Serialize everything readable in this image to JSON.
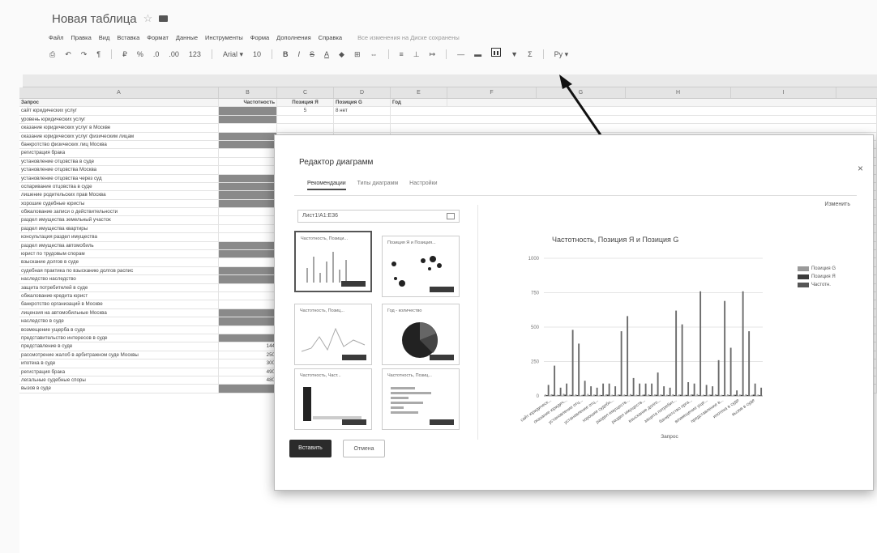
{
  "app": {
    "title": "Новая таблица",
    "menu": [
      "Файл",
      "Правка",
      "Вид",
      "Вставка",
      "Формат",
      "Данные",
      "Инструменты",
      "Форма",
      "Дополнения",
      "Справка"
    ],
    "last_edit": "Все изменения на Диске сохранены"
  },
  "toolbar": {
    "font_size": "10",
    "functions": "Σ"
  },
  "grid": {
    "col_letters": [
      "A",
      "B",
      "C",
      "D",
      "E",
      "F",
      "G",
      "H",
      "I"
    ],
    "header_row": [
      "Запрос",
      "Частотность",
      "Позиция Я",
      "Позиция G",
      "Год"
    ],
    "rows": [
      [
        "сайт юридических услуг",
        "",
        "5",
        "8 нет"
      ],
      [
        "уровень юридических услуг",
        "",
        "",
        ""
      ],
      [
        "оказание юридических услуг в Москве",
        "",
        "",
        ""
      ],
      [
        "оказание юридических услуг физическим лицам",
        "",
        "",
        ""
      ],
      [
        "банкротство физических лиц Москва",
        "",
        "",
        ""
      ],
      [
        "регистрация брака",
        "",
        "",
        ""
      ],
      [
        "установление отцовства в суде",
        "",
        "",
        ""
      ],
      [
        "установление отцовства Москва",
        "",
        "",
        ""
      ],
      [
        "установление отцовства через суд",
        "",
        "",
        ""
      ],
      [
        "оспаривание отцовства в суде",
        "",
        "",
        ""
      ],
      [
        "лишение родительских прав Москва",
        "",
        "",
        ""
      ],
      [
        "хорошие судебные юристы",
        "",
        "",
        ""
      ],
      [
        "обжалование записи о действительности",
        "",
        "",
        ""
      ],
      [
        "раздел имущества земельный участок",
        "",
        "",
        ""
      ],
      [
        "раздел имущества квартиры",
        "",
        "",
        ""
      ],
      [
        "консультация раздел имущества",
        "",
        "",
        ""
      ],
      [
        "раздел имущества автомобиль",
        "",
        "",
        ""
      ],
      [
        "юрист по трудовым спорам",
        "",
        "",
        ""
      ],
      [
        "взыскание долгов в суде",
        "",
        "",
        ""
      ],
      [
        "судебная практика по взысканию долгов распис",
        "",
        "",
        ""
      ],
      [
        "наследство наследство",
        "",
        "",
        ""
      ],
      [
        "защита потребителей в суде",
        "",
        "",
        ""
      ],
      [
        "обжалование кредита юрист",
        "",
        "",
        ""
      ],
      [
        "банкротство организаций в Москве",
        "",
        "",
        ""
      ],
      [
        "лицензия на автомобильные Москва",
        "",
        "",
        ""
      ],
      [
        "наследство в суде",
        "",
        "",
        ""
      ],
      [
        "возмещение ущерба в суде",
        "",
        "",
        ""
      ],
      [
        "представительство интересов в суде",
        "",
        "",
        ""
      ],
      [
        "представление в суде",
        "144",
        "",
        "31 нет"
      ],
      [
        "рассмотрение жалоб в арбитражном суде Москвы",
        "250",
        "",
        "17 нет"
      ],
      [
        "ипотека в суде",
        "300",
        "",
        "17 нет"
      ],
      [
        "регистрация брака",
        "490",
        "",
        "3 нет"
      ],
      [
        "легальные судебные споры",
        "480",
        "",
        "9 нет"
      ],
      [
        "вызов в суде",
        "",
        "",
        "55 нет"
      ]
    ]
  },
  "dialog": {
    "title": "Редактор диаграмм",
    "tabs": [
      "Рекомендации",
      "Типы диаграмм",
      "Настройки"
    ],
    "edit_link": "Изменить",
    "range": "Лист1!A1:E36",
    "thumbs": [
      "Частотность, Позици...",
      "Позиция Я и Позиция...",
      "Частотность, Позиц...",
      "Год - количество",
      "Частотность, Част...",
      "Частотность, Позиц..."
    ],
    "insert_label": "Вставить",
    "cancel_label": "Отмена"
  },
  "chart_data": {
    "type": "bar",
    "title": "Частотность, Позиция Я и Позиция G",
    "xlabel": "Запрос",
    "ylabel": "",
    "ylim": [
      0,
      1000
    ],
    "y_ticks": [
      "0",
      "250",
      "500",
      "750",
      "1000"
    ],
    "categories": [
      "c1",
      "c2",
      "c3",
      "c4",
      "c5",
      "c6",
      "c7",
      "c8",
      "c9",
      "c10",
      "c11",
      "c12",
      "c13",
      "c14",
      "c15",
      "c16",
      "c17",
      "c18",
      "c19",
      "c20",
      "c21",
      "c22",
      "c23",
      "c24",
      "c25",
      "c26",
      "c27",
      "c28",
      "c29",
      "c30",
      "c31",
      "c32",
      "c33",
      "c34",
      "c35",
      "c36"
    ],
    "x_tick_labels": [
      "сайт юридическ...",
      "оказание юридич...",
      "установление отц...",
      "установление отц...",
      "хорошие судебн...",
      "раздел имуществ...",
      "раздел имуществ...",
      "взыскание долго...",
      "защита потребит...",
      "банкротство орга...",
      "возмещение уще...",
      "представление в...",
      "ипотека в суде",
      "вызов в суде"
    ],
    "series": [
      {
        "name": "Позиция G",
        "values": [
          10,
          12,
          8,
          15,
          9,
          11,
          7,
          14,
          10,
          8,
          12,
          9,
          11,
          10,
          13,
          9,
          8,
          12,
          10,
          11,
          9,
          12,
          10,
          8,
          11,
          13,
          9,
          10,
          12,
          8,
          11,
          9,
          10,
          12,
          8,
          10
        ]
      },
      {
        "name": "Позиция Я",
        "values": [
          6,
          8,
          5,
          9,
          7,
          6,
          8,
          5,
          7,
          6,
          9,
          5,
          8,
          6,
          7,
          5,
          9,
          6,
          8,
          7,
          5,
          6,
          8,
          7,
          9,
          5,
          6,
          8,
          7,
          6,
          5,
          8,
          7,
          6,
          9,
          5
        ]
      },
      {
        "name": "Частотн.",
        "values": [
          80,
          220,
          60,
          90,
          480,
          380,
          110,
          70,
          60,
          90,
          90,
          70,
          470,
          580,
          130,
          90,
          90,
          90,
          170,
          70,
          60,
          620,
          520,
          100,
          90,
          760,
          80,
          70,
          260,
          690,
          350,
          40,
          760,
          470,
          90,
          60
        ]
      }
    ],
    "legend_position": "top-right"
  },
  "colors": {
    "series_g": "#9a9a9a",
    "series_ya": "#3c3c3c",
    "series_freq": "#6a6a6a",
    "highlight": "#8a8a8a"
  }
}
